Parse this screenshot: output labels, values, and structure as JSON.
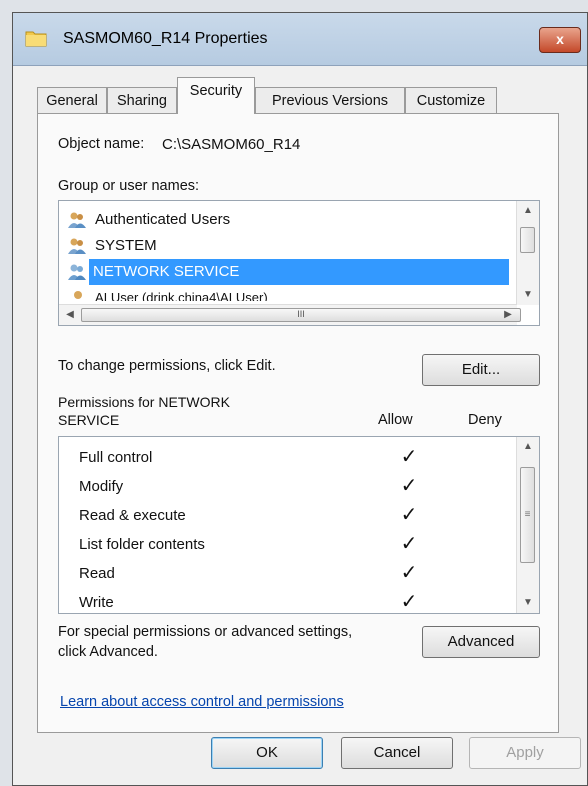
{
  "window": {
    "title": "SASMOM60_R14 Properties",
    "close_label": "x"
  },
  "tabs": [
    {
      "label": "General",
      "active": false
    },
    {
      "label": "Sharing",
      "active": false
    },
    {
      "label": "Security",
      "active": true
    },
    {
      "label": "Previous Versions",
      "active": false
    },
    {
      "label": "Customize",
      "active": false
    }
  ],
  "security": {
    "object_name_label": "Object name:",
    "object_name_value": "C:\\SASMOM60_R14",
    "group_label": "Group or user names:",
    "users": [
      {
        "name": "Authenticated Users",
        "icon": "users-icon",
        "selected": false
      },
      {
        "name": "SYSTEM",
        "icon": "users-icon",
        "selected": false
      },
      {
        "name": "NETWORK SERVICE",
        "icon": "users-icon",
        "selected": true
      },
      {
        "name": "AI User (drink.china4\\AI User)",
        "icon": "user-icon",
        "selected": false
      }
    ],
    "hscroll_grip": "III",
    "change_text": "To change permissions, click Edit.",
    "edit_button": "Edit...",
    "permissions_for_line1": "Permissions for NETWORK",
    "permissions_for_line2": "SERVICE",
    "allow_header": "Allow",
    "deny_header": "Deny",
    "permissions": [
      {
        "name": "Full control",
        "allow": "✓",
        "deny": ""
      },
      {
        "name": "Modify",
        "allow": "✓",
        "deny": ""
      },
      {
        "name": "Read & execute",
        "allow": "✓",
        "deny": ""
      },
      {
        "name": "List folder contents",
        "allow": "✓",
        "deny": ""
      },
      {
        "name": "Read",
        "allow": "✓",
        "deny": ""
      },
      {
        "name": "Write",
        "allow": "✓",
        "deny": ""
      }
    ],
    "vscroll_grip": "≡",
    "special_line1": "For special permissions or advanced settings,",
    "special_line2": "click Advanced.",
    "advanced_button": "Advanced",
    "learn_link": "Learn about access control and permissions"
  },
  "footer": {
    "ok": "OK",
    "cancel": "Cancel",
    "apply": "Apply"
  },
  "colors": {
    "selection": "#3399ff",
    "link": "#0645ad",
    "titlebar": "#c9d9ea"
  }
}
